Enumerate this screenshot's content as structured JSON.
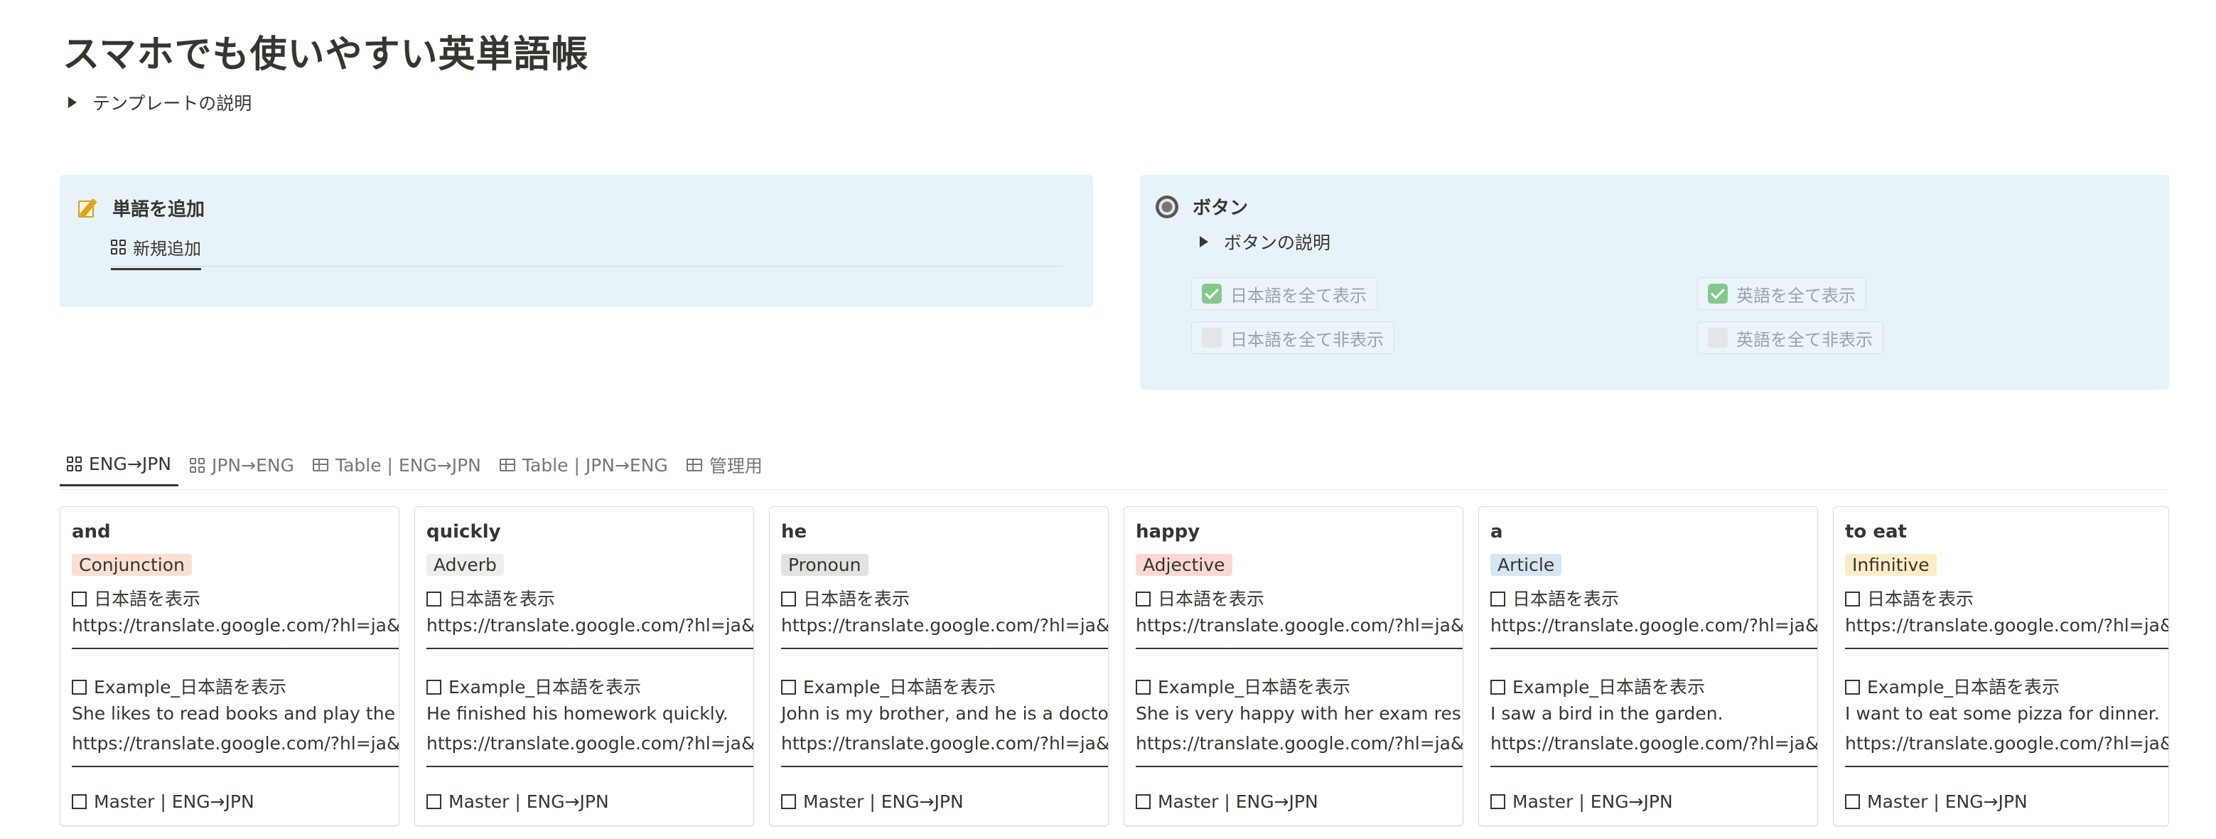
{
  "page": {
    "title": "スマホでも使いやすい英単語帳",
    "template_toggle": "テンプレートの説明"
  },
  "add_callout": {
    "heading": "単語を追加",
    "icon": "memo-icon",
    "new_button": "新規追加"
  },
  "button_callout": {
    "heading": "ボタン",
    "icon": "radio-button-icon",
    "toggle": "ボタンの説明",
    "buttons": [
      {
        "label": "日本語を全て表示",
        "checked": true
      },
      {
        "label": "英語を全て表示",
        "checked": true
      },
      {
        "label": "日本語を全て非表示",
        "checked": false
      },
      {
        "label": "英語を全て非表示",
        "checked": false
      }
    ]
  },
  "views": {
    "tabs": [
      {
        "label": "ENG→JPN",
        "icon": "gallery-icon",
        "active": true
      },
      {
        "label": "JPN→ENG",
        "icon": "gallery-icon",
        "active": false
      },
      {
        "label": "Table | ENG→JPN",
        "icon": "table-icon",
        "active": false
      },
      {
        "label": "Table | JPN→ENG",
        "icon": "table-icon",
        "active": false
      },
      {
        "label": "管理用",
        "icon": "table-icon",
        "active": false
      }
    ]
  },
  "cards": [
    {
      "word": "and",
      "pos": "Conjunction",
      "pos_bg": "#fadfd3",
      "pos_fg": "#37352f",
      "show_jp": "日本語を表示",
      "url1": "https://translate.google.com/?hl=ja&sl=en",
      "show_example": "Example_日本語を表示",
      "example": "She likes to read books and play the piano.",
      "url2": "https://translate.google.com/?hl=ja&sl=en",
      "master": "Master | ENG→JPN"
    },
    {
      "word": "quickly",
      "pos": "Adverb",
      "pos_bg": "#eeeeec",
      "pos_fg": "#37352f",
      "show_jp": "日本語を表示",
      "url1": "https://translate.google.com/?hl=ja&sl=en",
      "show_example": "Example_日本語を表示",
      "example": "He finished his homework quickly.",
      "url2": "https://translate.google.com/?hl=ja&sl=en",
      "master": "Master | ENG→JPN"
    },
    {
      "word": "he",
      "pos": "Pronoun",
      "pos_bg": "#e3e2e0",
      "pos_fg": "#37352f",
      "show_jp": "日本語を表示",
      "url1": "https://translate.google.com/?hl=ja&sl=en",
      "show_example": "Example_日本語を表示",
      "example": "John is my brother, and he is a doctor.",
      "url2": "https://translate.google.com/?hl=ja&sl=en",
      "master": "Master | ENG→JPN"
    },
    {
      "word": "happy",
      "pos": "Adjective",
      "pos_bg": "#fbd8d4",
      "pos_fg": "#37352f",
      "show_jp": "日本語を表示",
      "url1": "https://translate.google.com/?hl=ja&sl=en",
      "show_example": "Example_日本語を表示",
      "example": "She is very happy with her exam results.",
      "url2": "https://translate.google.com/?hl=ja&sl=en",
      "master": "Master | ENG→JPN"
    },
    {
      "word": "a",
      "pos": "Article",
      "pos_bg": "#d6e6f2",
      "pos_fg": "#37352f",
      "show_jp": "日本語を表示",
      "url1": "https://translate.google.com/?hl=ja&sl=en",
      "show_example": "Example_日本語を表示",
      "example": "I saw a bird in the garden.",
      "url2": "https://translate.google.com/?hl=ja&sl=en",
      "master": "Master | ENG→JPN"
    },
    {
      "word": "to eat",
      "pos": "Infinitive",
      "pos_bg": "#fbecc6",
      "pos_fg": "#37352f",
      "show_jp": "日本語を表示",
      "url1": "https://translate.google.com/?hl=ja&sl=en",
      "show_example": "Example_日本語を表示",
      "example": "I want to eat some pizza for dinner.",
      "url2": "https://translate.google.com/?hl=ja&sl=en",
      "master": "Master | ENG→JPN"
    }
  ]
}
